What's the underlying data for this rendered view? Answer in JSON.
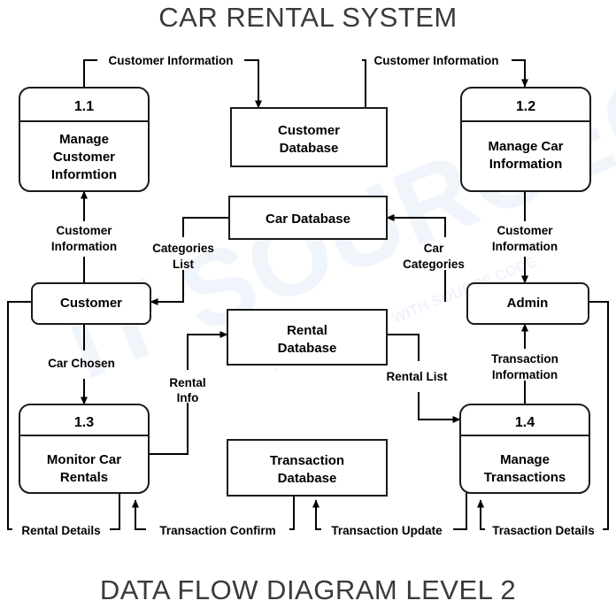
{
  "diagram": {
    "top_title": "CAR RENTAL SYSTEM",
    "bottom_title": "DATA FLOW DIAGRAM LEVEL 2",
    "watermark": "IT SOURCECODE",
    "watermark_sub": "FREE PROJECTS WITH SOURCE CODE",
    "stroke_color": "#1a1a1a",
    "title_color": "#3a3a3a",
    "background": "#ffffff"
  },
  "processes": [
    {
      "id": "1.1",
      "number": "1.1",
      "line1": "Manage",
      "line2": "Customer",
      "line3": "Informtion"
    },
    {
      "id": "1.2",
      "number": "1.2",
      "line1": "Manage Car",
      "line2": "Information",
      "line3": ""
    },
    {
      "id": "1.3",
      "number": "1.3",
      "line1": "Monitor Car",
      "line2": "Rentals",
      "line3": ""
    },
    {
      "id": "1.4",
      "number": "1.4",
      "line1": "Manage",
      "line2": "Transactions",
      "line3": ""
    }
  ],
  "datastores": [
    {
      "id": "customer-database",
      "line1": "Customer",
      "line2": "Database"
    },
    {
      "id": "car-database",
      "line1": "Car Database",
      "line2": ""
    },
    {
      "id": "rental-database",
      "line1": "Rental",
      "line2": "Database"
    },
    {
      "id": "transaction-database",
      "line1": "Transaction",
      "line2": "Database"
    }
  ],
  "entities": [
    {
      "id": "customer",
      "label": "Customer"
    },
    {
      "id": "admin",
      "label": "Admin"
    }
  ],
  "flows": [
    {
      "id": "f1",
      "line1": "Customer Information",
      "line2": "",
      "from": "1.1",
      "to": "customer-database"
    },
    {
      "id": "f2",
      "line1": "Customer Information",
      "line2": "",
      "from": "customer-database",
      "to": "1.2"
    },
    {
      "id": "f3",
      "line1": "Customer",
      "line2": "Information",
      "from": "customer",
      "to": "1.1"
    },
    {
      "id": "f4",
      "line1": "Customer",
      "line2": "Information",
      "from": "1.2",
      "to": "admin"
    },
    {
      "id": "f5",
      "line1": "Categories",
      "line2": "List",
      "from": "car-database",
      "to": "customer"
    },
    {
      "id": "f6",
      "line1": "Car",
      "line2": "Categories",
      "from": "admin",
      "to": "car-database"
    },
    {
      "id": "f7",
      "line1": "Car Chosen",
      "line2": "",
      "from": "customer",
      "to": "1.3"
    },
    {
      "id": "f8",
      "line1": "Rental",
      "line2": "Info",
      "from": "1.3",
      "to": "rental-database"
    },
    {
      "id": "f9",
      "line1": "Rental List",
      "line2": "",
      "from": "rental-database",
      "to": "1.4"
    },
    {
      "id": "f10",
      "line1": "Transaction",
      "line2": "Information",
      "from": "1.4",
      "to": "admin"
    },
    {
      "id": "f11",
      "line1": "Rental Details",
      "line2": "",
      "from": "1.3",
      "to": "customer"
    },
    {
      "id": "f12",
      "line1": "Transaction Confirm",
      "line2": "",
      "from": "transaction-database",
      "to": "1.3"
    },
    {
      "id": "f13",
      "line1": "Transaction Update",
      "line2": "",
      "from": "1.4",
      "to": "transaction-database"
    },
    {
      "id": "f14",
      "line1": "Trasaction Details",
      "line2": "",
      "from": "admin",
      "to": "1.4"
    }
  ]
}
